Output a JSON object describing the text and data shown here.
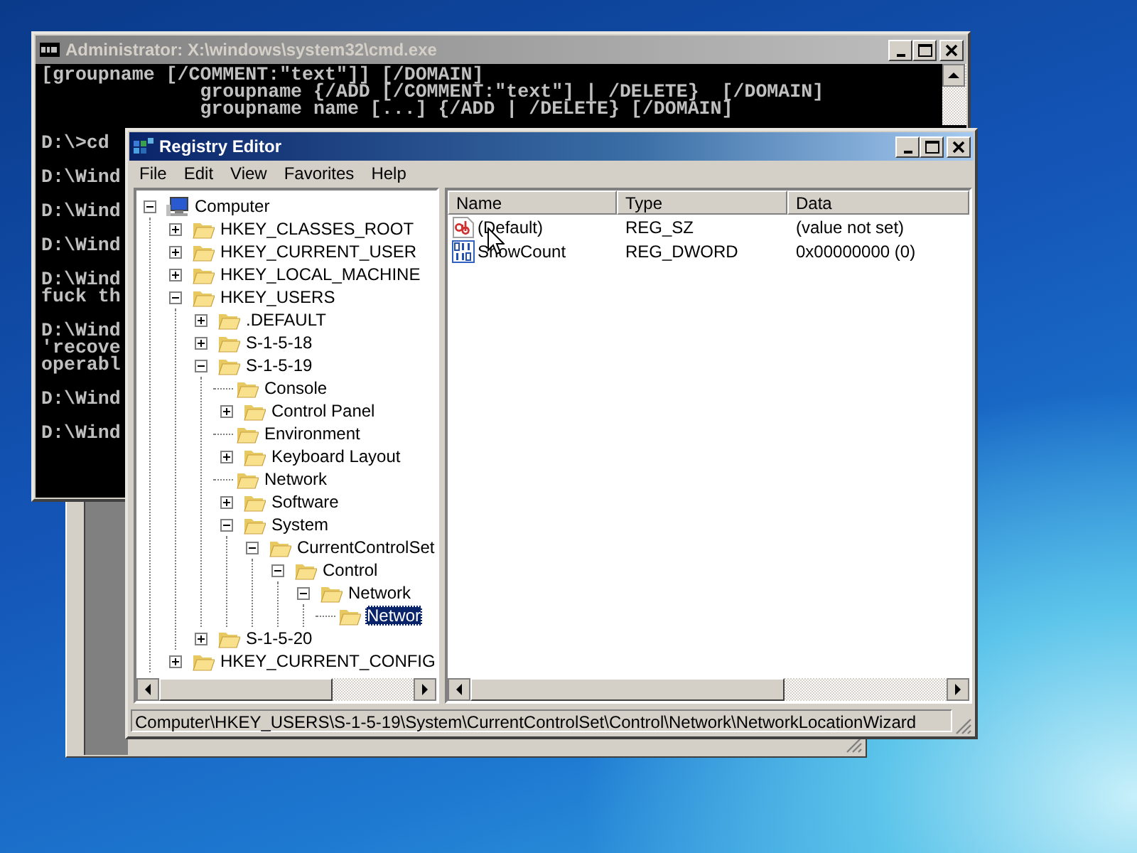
{
  "console_window": {
    "title": "Administrator: X:\\windows\\system32\\cmd.exe",
    "active": false,
    "output": [
      [
        "[groupname [/COMMENT:\"text\"]] [/DOMAIN]",
        "              groupname {/ADD [/COMMENT:\"text\"] | /DELETE}  [/DOMAIN]",
        "              groupname name [...] {/ADD | /DELETE} [/DOMAIN]"
      ],
      [
        "D:\\>cd"
      ],
      [
        "D:\\Wind"
      ],
      [
        "D:\\Wind"
      ],
      [
        "D:\\Wind"
      ],
      [
        "D:\\Wind",
        "fuck th"
      ],
      [
        "D:\\Wind",
        "'recove",
        "operabl"
      ],
      [
        "D:\\Wind"
      ],
      [
        "D:\\Wind"
      ]
    ]
  },
  "registry_window": {
    "title": "Registry Editor",
    "active": true,
    "menu": [
      "File",
      "Edit",
      "View",
      "Favorites",
      "Help"
    ],
    "tree": [
      {
        "label": "Computer",
        "kind": "computer",
        "expanded": true,
        "selected": false,
        "children": [
          {
            "label": "HKEY_CLASSES_ROOT",
            "kind": "folder",
            "expanded": false,
            "selected": false
          },
          {
            "label": "HKEY_CURRENT_USER",
            "kind": "folder",
            "expanded": false,
            "selected": false
          },
          {
            "label": "HKEY_LOCAL_MACHINE",
            "kind": "folder",
            "expanded": false,
            "selected": false
          },
          {
            "label": "HKEY_USERS",
            "kind": "folder",
            "expanded": true,
            "selected": false,
            "children": [
              {
                "label": ".DEFAULT",
                "kind": "folder",
                "expanded": false,
                "selected": false
              },
              {
                "label": "S-1-5-18",
                "kind": "folder",
                "expanded": false,
                "selected": false
              },
              {
                "label": "S-1-5-19",
                "kind": "folder",
                "expanded": true,
                "selected": false,
                "children": [
                  {
                    "label": "Console",
                    "kind": "folder",
                    "selected": false
                  },
                  {
                    "label": "Control Panel",
                    "kind": "folder",
                    "expanded": false,
                    "selected": false
                  },
                  {
                    "label": "Environment",
                    "kind": "folder",
                    "selected": false
                  },
                  {
                    "label": "Keyboard Layout",
                    "kind": "folder",
                    "expanded": false,
                    "selected": false
                  },
                  {
                    "label": "Network",
                    "kind": "folder",
                    "selected": false
                  },
                  {
                    "label": "Software",
                    "kind": "folder",
                    "expanded": false,
                    "selected": false
                  },
                  {
                    "label": "System",
                    "kind": "folder",
                    "expanded": true,
                    "selected": false,
                    "children": [
                      {
                        "label": "CurrentControlSet",
                        "kind": "folder",
                        "expanded": true,
                        "selected": false,
                        "children": [
                          {
                            "label": "Control",
                            "kind": "folder",
                            "expanded": true,
                            "selected": false,
                            "children": [
                              {
                                "label": "Network",
                                "kind": "folder",
                                "expanded": true,
                                "selected": false,
                                "children": [
                                  {
                                    "label": "Networ",
                                    "kind": "folder",
                                    "selected": true
                                  }
                                ]
                              }
                            ]
                          }
                        ]
                      }
                    ]
                  }
                ]
              },
              {
                "label": "S-1-5-20",
                "kind": "folder",
                "expanded": false,
                "selected": false
              }
            ]
          },
          {
            "label": "HKEY_CURRENT_CONFIG",
            "kind": "folder",
            "expanded": false,
            "selected": false
          }
        ]
      }
    ],
    "columns": [
      "Name",
      "Type",
      "Data"
    ],
    "values": [
      {
        "kind": "string",
        "name": "(Default)",
        "type": "REG_SZ",
        "data": "(value not set)"
      },
      {
        "kind": "dword",
        "name": "ShowCount",
        "type": "REG_DWORD",
        "data": "0x00000000 (0)"
      }
    ],
    "status_bar": "Computer\\HKEY_USERS\\S-1-5-19\\System\\CurrentControlSet\\Control\\Network\\NetworkLocationWizard"
  }
}
